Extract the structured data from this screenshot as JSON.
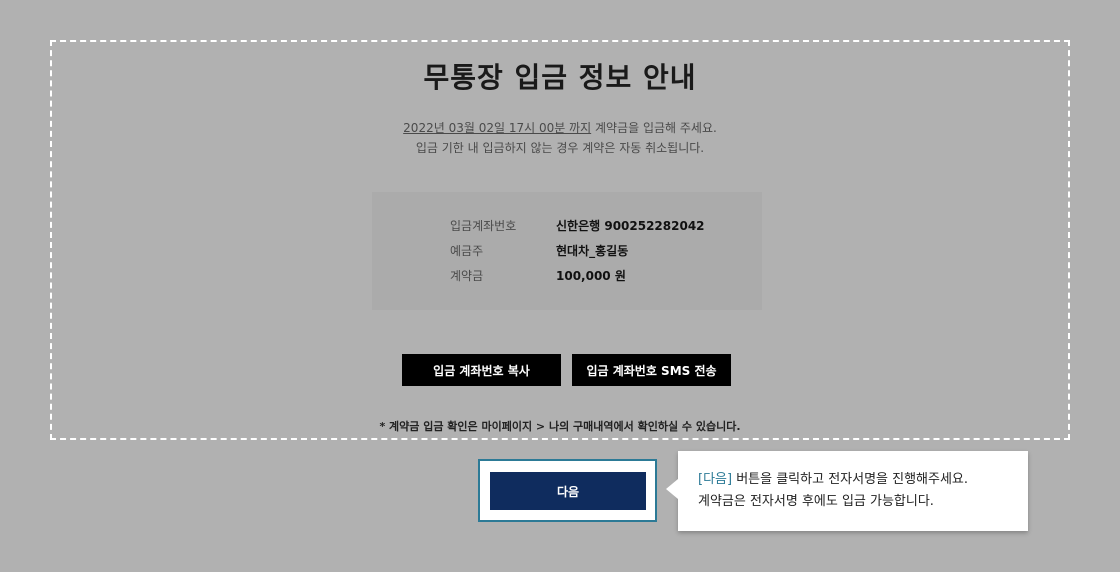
{
  "panel": {
    "title": "무통장 입금 정보 안내",
    "notice": {
      "deadline": "2022년 03월 02일 17시 00분 까지",
      "line1_suffix": " 계약금을 입금해 주세요.",
      "line2": "입금 기한 내 입금하지 않는 경우 계약은 자동 취소됩니다."
    },
    "info": {
      "rows": [
        {
          "label": "입금계좌번호",
          "value": "신한은행  900252282042"
        },
        {
          "label": "예금주",
          "value": "현대차_홍길동"
        },
        {
          "label": "계약금",
          "value": "100,000 원"
        }
      ]
    },
    "buttons": {
      "copy_label": "입금 계좌번호 복사",
      "sms_label": "입금 계좌번호 SMS 전송"
    },
    "footnote": "* 계약금 입금 확인은 마이페이지 > 나의 구매내역에서 확인하실 수 있습니다."
  },
  "next_button": {
    "label": "다음"
  },
  "tooltip": {
    "keyword": "[다음]",
    "line1_rest": " 버튼을 클릭하고 전자서명을 진행해주세요.",
    "line2": "계약금은 전자서명 후에도 입금 가능합니다."
  },
  "colors": {
    "overlay": "#b1b1b1",
    "accent": "#2c7a96",
    "primary_button": "#0f2c5e",
    "dark_button": "#000000"
  }
}
